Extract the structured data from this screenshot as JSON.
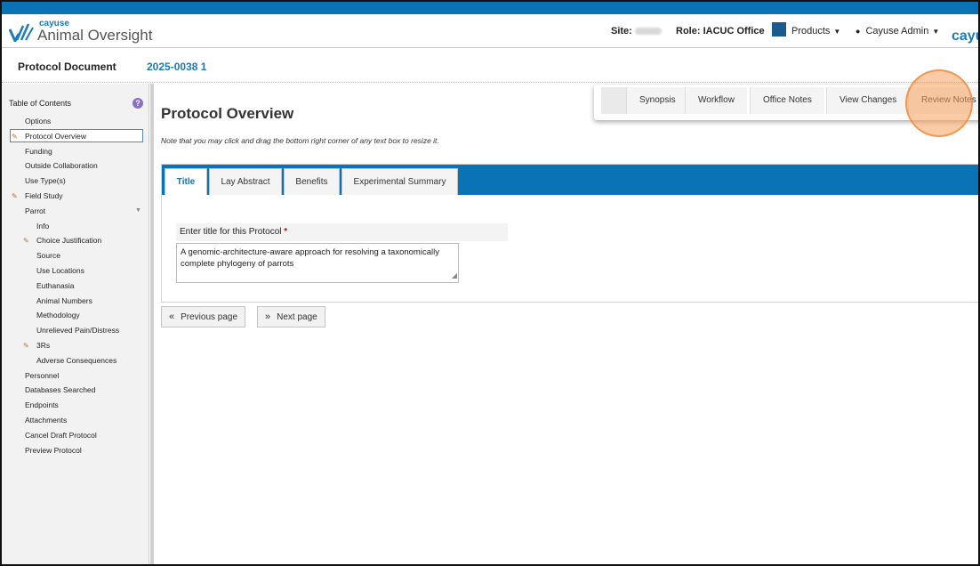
{
  "colors": {
    "brand_blue": "#0a73b6",
    "link_blue": "#1c7ab8",
    "highlight": "#f5a05a",
    "required": "#d0021b"
  },
  "header": {
    "brand_small": "cayuse",
    "brand_big": "Animal Oversight",
    "site_label": "Site:",
    "role_label": "Role:",
    "role_value": "IACUC Office",
    "products_label": "Products",
    "user_label": "Cayuse Admin",
    "right_logo_text": "cayu"
  },
  "subheader": {
    "title": "Protocol Document",
    "protocol_number": "2025-0038 1"
  },
  "sidebar": {
    "toc_title": "Table of Contents",
    "help_icon": "?",
    "items": [
      {
        "label": "Options",
        "indent": 1,
        "icon": false
      },
      {
        "label": "Protocol Overview",
        "indent": 1,
        "icon": true
      },
      {
        "label": "Funding",
        "indent": 1,
        "icon": false
      },
      {
        "label": "Outside Collaboration",
        "indent": 1,
        "icon": false
      },
      {
        "label": "Use Type(s)",
        "indent": 1,
        "icon": false
      },
      {
        "label": "Field Study",
        "indent": 1,
        "icon": true
      },
      {
        "label": "Parrot",
        "indent": 1,
        "icon": false
      },
      {
        "label": "Info",
        "indent": 2,
        "icon": false
      },
      {
        "label": "Choice Justification",
        "indent": 2,
        "icon": true
      },
      {
        "label": "Source",
        "indent": 2,
        "icon": false
      },
      {
        "label": "Use Locations",
        "indent": 2,
        "icon": false
      },
      {
        "label": "Euthanasia",
        "indent": 2,
        "icon": false
      },
      {
        "label": "Animal Numbers",
        "indent": 2,
        "icon": false
      },
      {
        "label": "Methodology",
        "indent": 2,
        "icon": false
      },
      {
        "label": "Unrelieved Pain/Distress",
        "indent": 2,
        "icon": false
      },
      {
        "label": "3Rs",
        "indent": 2,
        "icon": true
      },
      {
        "label": "Adverse Consequences",
        "indent": 2,
        "icon": false
      },
      {
        "label": "Personnel",
        "indent": 1,
        "icon": false
      },
      {
        "label": "Databases Searched",
        "indent": 1,
        "icon": false
      },
      {
        "label": "Endpoints",
        "indent": 1,
        "icon": false
      },
      {
        "label": "Attachments",
        "indent": 1,
        "icon": false
      },
      {
        "label": "Cancel Draft Protocol",
        "indent": 1,
        "icon": false
      },
      {
        "label": "Preview Protocol",
        "indent": 1,
        "icon": false
      }
    ]
  },
  "main": {
    "title": "Protocol Overview",
    "note": "Note that you may click and drag the bottom right corner of any text box to resize it.",
    "tabs": [
      "Title",
      "Lay Abstract",
      "Benefits",
      "Experimental Summary"
    ],
    "field_label": "Enter title for this Protocol",
    "required_mark": "*",
    "field_value": "A genomic-architecture-aware approach for resolving a taxonomically complete phylogeny of parrots",
    "prev_label": "Previous page",
    "next_label": "Next page"
  },
  "right_nav": [
    "Synopsis",
    "Workflow",
    "Office Notes",
    "View Changes",
    "Review Notes"
  ]
}
